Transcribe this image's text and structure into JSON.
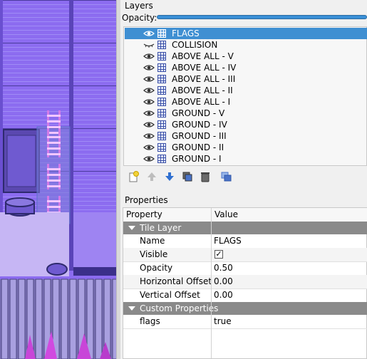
{
  "layers_panel": {
    "title": "Layers",
    "opacity_label": "Opacity:",
    "opacity_value": 1.0,
    "layers": [
      {
        "name": "FLAGS",
        "visible": true,
        "selected": true
      },
      {
        "name": "COLLISION",
        "visible": false,
        "selected": false
      },
      {
        "name": "ABOVE ALL - V",
        "visible": true,
        "selected": false
      },
      {
        "name": "ABOVE ALL - IV",
        "visible": true,
        "selected": false
      },
      {
        "name": "ABOVE ALL - III",
        "visible": true,
        "selected": false
      },
      {
        "name": "ABOVE ALL - II",
        "visible": true,
        "selected": false
      },
      {
        "name": "ABOVE ALL - I",
        "visible": true,
        "selected": false
      },
      {
        "name": "GROUND - V",
        "visible": true,
        "selected": false
      },
      {
        "name": "GROUND - IV",
        "visible": true,
        "selected": false
      },
      {
        "name": "GROUND - III",
        "visible": true,
        "selected": false
      },
      {
        "name": "GROUND - II",
        "visible": true,
        "selected": false
      },
      {
        "name": "GROUND - I",
        "visible": true,
        "selected": false
      }
    ],
    "toolbar": [
      {
        "icon": "new-layer-icon"
      },
      {
        "icon": "move-layer-up-icon"
      },
      {
        "icon": "move-layer-down-icon"
      },
      {
        "icon": "duplicate-layer-icon"
      },
      {
        "icon": "delete-layer-icon"
      },
      {
        "icon": "show-hide-others-icon"
      }
    ]
  },
  "properties_panel": {
    "title": "Properties",
    "header": {
      "property": "Property",
      "value": "Value"
    },
    "groups": [
      {
        "label": "Tile Layer",
        "rows": [
          {
            "name": "Name",
            "value": "FLAGS"
          },
          {
            "name": "Visible",
            "value": "✓"
          },
          {
            "name": "Opacity",
            "value": "0.50"
          },
          {
            "name": "Horizontal Offset",
            "value": "0.00"
          },
          {
            "name": "Vertical Offset",
            "value": "0.00"
          }
        ]
      },
      {
        "label": "Custom Properties",
        "rows": [
          {
            "name": "flags",
            "value": "true"
          }
        ]
      }
    ]
  },
  "colors": {
    "map_purple": "#8c6cf0",
    "selection_blue": "#3f8fd2",
    "group_header": "#8a8a8a"
  }
}
